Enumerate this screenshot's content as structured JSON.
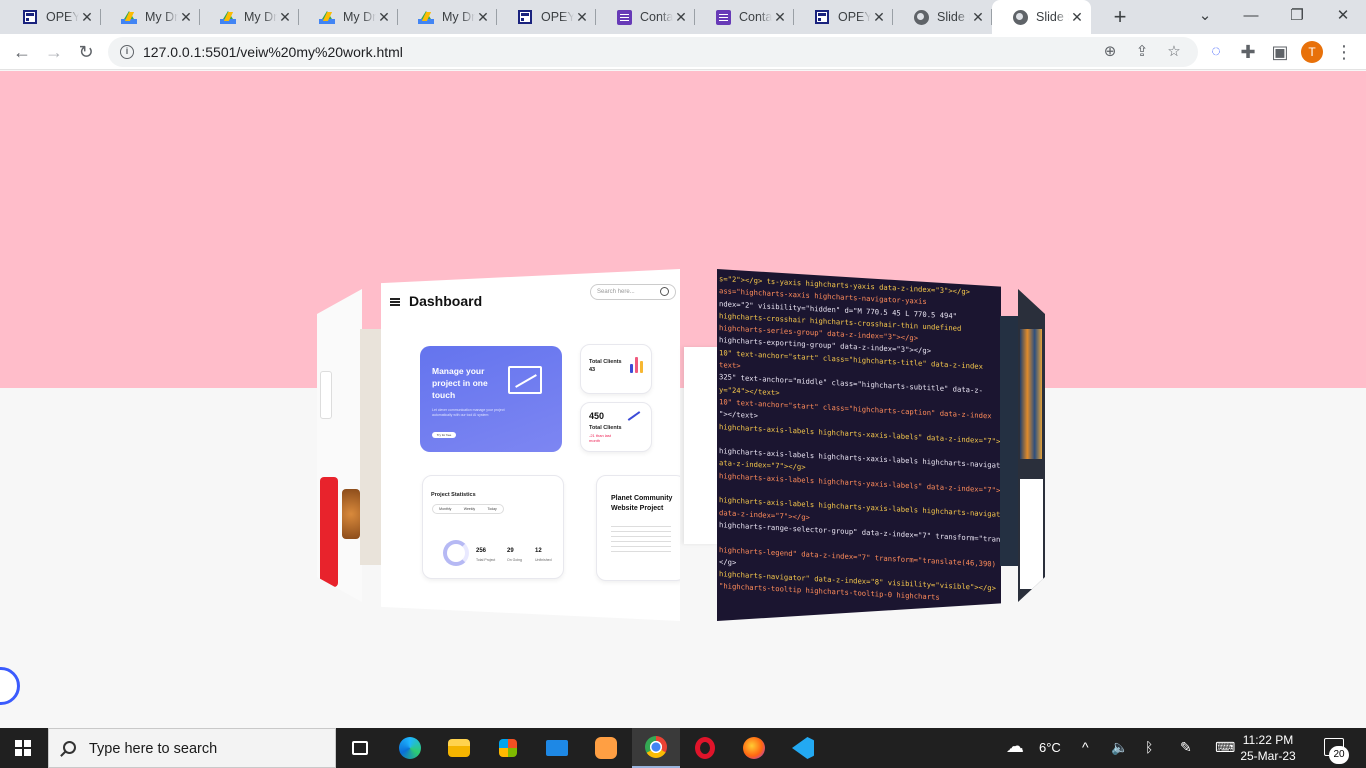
{
  "browser": {
    "tabs": [
      {
        "label": "OPEYE",
        "favicon": "forms-icon"
      },
      {
        "label": "My Dri",
        "favicon": "drive-icon"
      },
      {
        "label": "My Dri",
        "favicon": "drive-icon"
      },
      {
        "label": "My Dri",
        "favicon": "drive-icon"
      },
      {
        "label": "My Dri",
        "favicon": "drive-icon"
      },
      {
        "label": "OPEYE",
        "favicon": "forms-icon"
      },
      {
        "label": "Contac",
        "favicon": "list-icon"
      },
      {
        "label": "Contac",
        "favicon": "list-icon"
      },
      {
        "label": "OPEYE",
        "favicon": "forms-icon"
      },
      {
        "label": "Slide S",
        "favicon": "globe-icon"
      },
      {
        "label": "Slide S",
        "favicon": "globe-icon",
        "active": true
      }
    ],
    "new_tab": "+",
    "window_controls": {
      "dropdown": "⌄",
      "minimize": "—",
      "restore": "❐",
      "close": "✕"
    },
    "nav": {
      "back": "←",
      "forward": "→",
      "reload": "↻"
    },
    "url": "127.0.0.1:5501/veiw%20my%20work.html",
    "profile_initial": "T",
    "menu": "⋮"
  },
  "page": {
    "pink_color": "#ffbdca",
    "dashboard": {
      "title": "Dashboard",
      "search_placeholder": "Search here...",
      "hero_title": "Manage your project in one touch",
      "hero_sub": "Let clever communication manage your project automatically with our tool AI system",
      "hero_button": "Try for free",
      "card1_title": "Total Clients",
      "card1_value": "43",
      "card2_value": "450",
      "card2_title": "Total Clients",
      "card2_sub": "-21 than last month",
      "stats_title": "Project Statistics",
      "stats_tabs": [
        "Monthly",
        "Weekly",
        "Today"
      ],
      "stats": [
        {
          "value": "256",
          "label": "Total Project"
        },
        {
          "value": "29",
          "label": "On Going"
        },
        {
          "value": "12",
          "label": "Unfinished"
        }
      ],
      "planet_title": "Planet Community Website Project"
    },
    "code_lines": [
      "s=\"2\"></g>    ts-yaxis highcharts-yaxis data-z-index=\"3\"></g>",
      "ass=\"highcharts-xaxis highcharts-navigator-yaxis",
      "ndex=\"2\" visibility=\"hidden\" d=\"M 770.5 45 L 770.5 494\"",
      "highcharts-crosshair highcharts-crosshair-thin undefined",
      "highcharts-series-group\" data-z-index=\"3\"></g>",
      "highcharts-exporting-group\" data-z-index=\"3\"></g>",
      "10\" text-anchor=\"start\" class=\"highcharts-title\" data-z-index",
      "text>",
      "325\" text-anchor=\"middle\" class=\"highcharts-subtitle\" data-z-",
      "y=\"24\"></text>",
      "10\" text-anchor=\"start\" class=\"highcharts-caption\" data-z-index",
      "\"></text>",
      "highcharts-axis-labels highcharts-xaxis-labels\" data-z-index=\"7\">",
      "",
      "highcharts-axis-labels highcharts-xaxis-labels highcharts-navigat",
      "ata-z-index=\"7\"></g>",
      "highcharts-axis-labels highcharts-yaxis-labels\" data-z-index=\"7\">",
      "",
      "highcharts-axis-labels highcharts-yaxis-labels highcharts-navigat",
      "data-z-index=\"7\"></g>",
      "highcharts-range-selector-group\" data-z-index=\"7\" transform=\"tran",
      "",
      "highcharts-legend\" data-z-index=\"7\" transform=\"translate(46,390)",
      "</g>",
      "highcharts-navigator\" data-z-index=\"8\" visibility=\"visible\"></g>",
      "   \"highcharts-tooltip highcharts-tooltip-0 highcharts"
    ]
  },
  "taskbar": {
    "search_placeholder": "Type here to search",
    "weather": "6°C",
    "time": "11:22 PM",
    "date": "25-Mar-23",
    "notification_count": "20"
  }
}
